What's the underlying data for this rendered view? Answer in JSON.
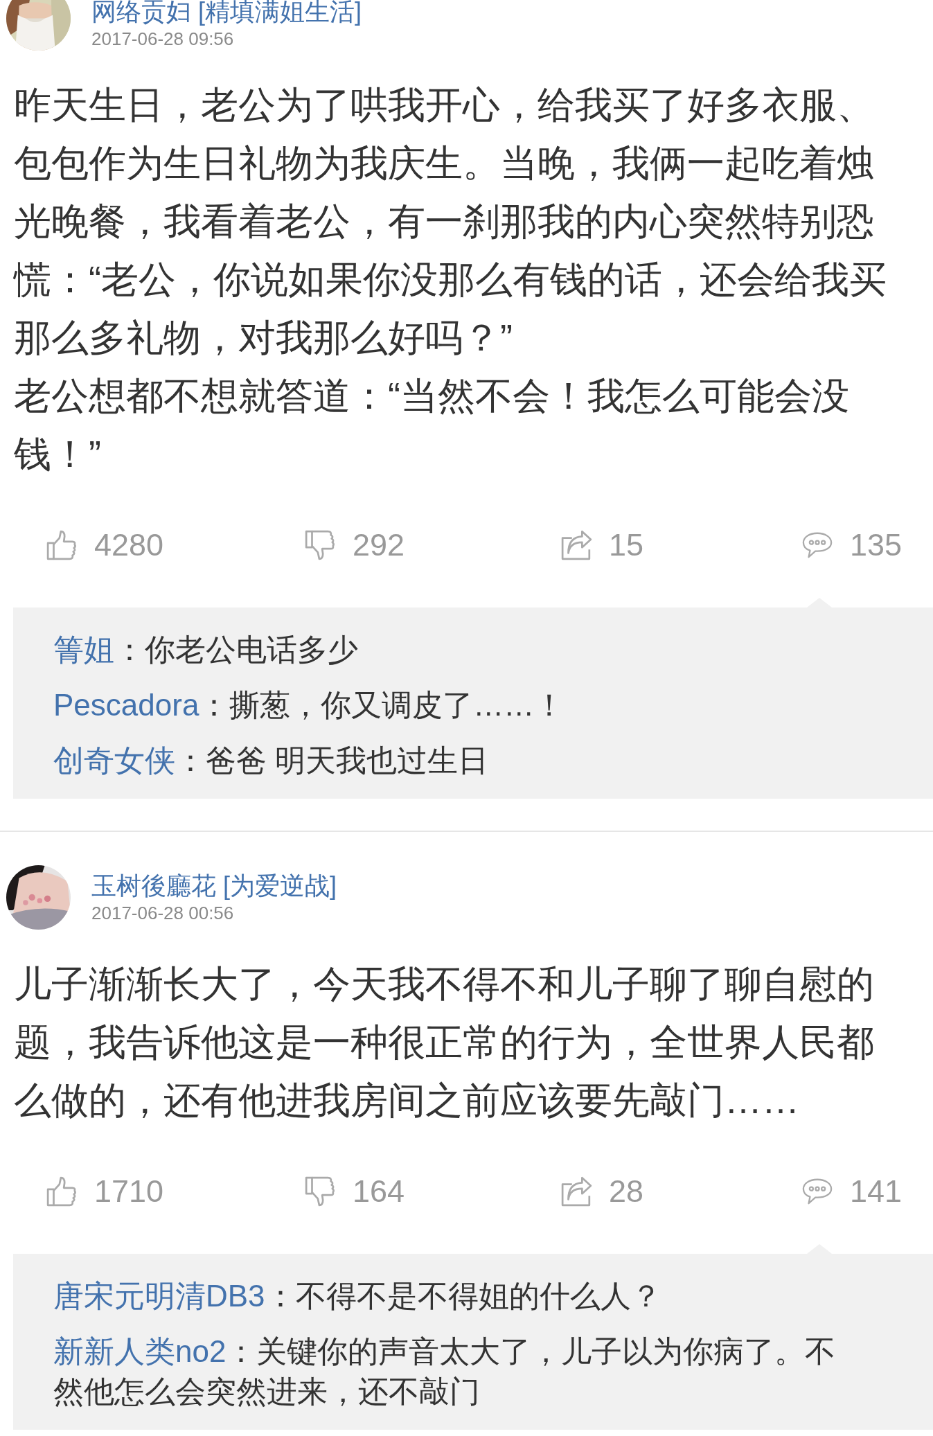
{
  "posts": [
    {
      "author": "网络贡妇 [精填满姐生活]",
      "time": "2017-06-28 09:56",
      "lines": [
        "昨天生日，老公为了哄我开心，给我买了好多衣服、",
        "包包作为生日礼物为我庆生。当晚，我俩一起吃着烛",
        "光晚餐，我看着老公，有一刹那我的内心突然特别恐",
        "慌：“老公，你说如果你没那么有钱的话，还会给我买",
        "那么多礼物，对我那么好吗？”",
        "老公想都不想就答道：“当然不会！我怎么可能会没",
        "钱！”"
      ],
      "stats": [
        {
          "kind": "like",
          "count": "4280"
        },
        {
          "kind": "dislike",
          "count": "292"
        },
        {
          "kind": "share",
          "count": "15"
        },
        {
          "kind": "comment",
          "count": "135"
        }
      ],
      "replies": [
        {
          "user": "箐姐",
          "text": "：你老公电话多少"
        },
        {
          "user": "Pescadora",
          "text": "：撕葱，你又调皮了……！"
        },
        {
          "user": "创奇女侠",
          "text": "：爸爸 明天我也过生日"
        }
      ]
    },
    {
      "author": "玉树後廳花 [为爱逆战]",
      "time": "2017-06-28 00:56",
      "lines": [
        "儿子渐渐长大了，今天我不得不和儿子聊了聊自慰的",
        "题，我告诉他这是一种很正常的行为，全世界人民都",
        "么做的，还有他进我房间之前应该要先敲门……"
      ],
      "stats": [
        {
          "kind": "like",
          "count": "1710"
        },
        {
          "kind": "dislike",
          "count": "164"
        },
        {
          "kind": "share",
          "count": "28"
        },
        {
          "kind": "comment",
          "count": "141"
        }
      ],
      "replies": [
        {
          "user": "唐宋元明清DB3",
          "text": "：不得不是不得姐的什么人？"
        },
        {
          "user": "新新人类no2",
          "text": "：关键你的声音太大了，儿子以为你病了。不然他怎么会突然进来，还不敲门"
        }
      ]
    }
  ]
}
